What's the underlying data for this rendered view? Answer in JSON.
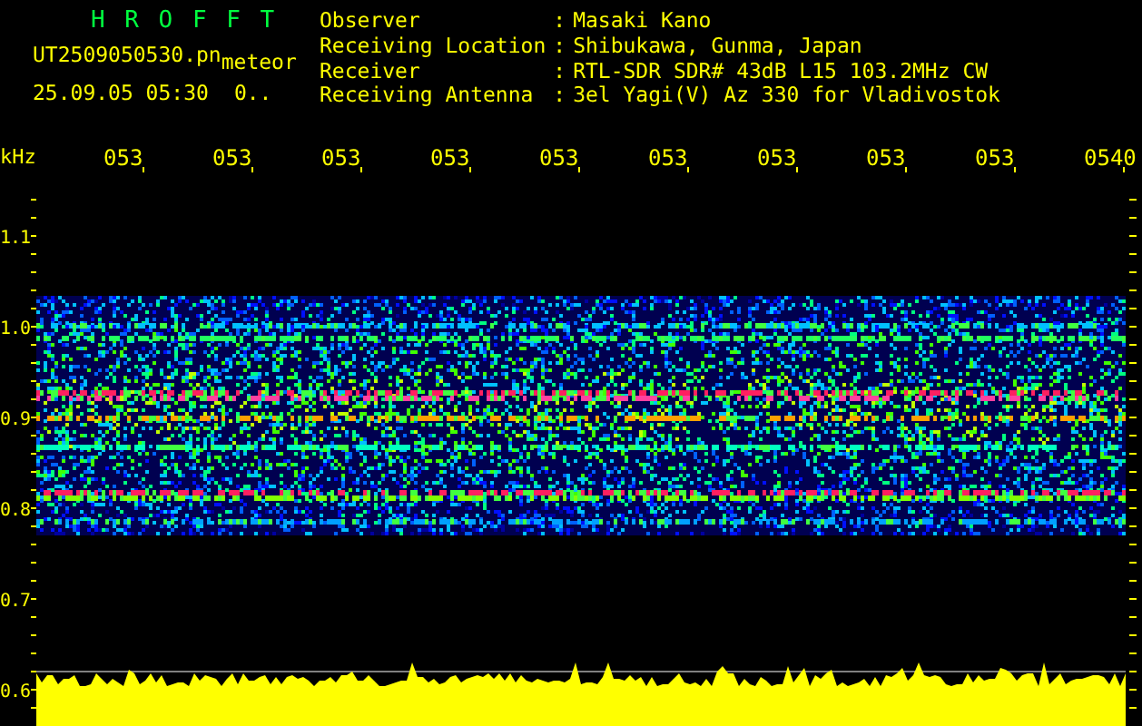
{
  "header": {
    "title": "H R O F F T",
    "file_name": "UT2509050530.pn",
    "mode": "meteor",
    "timestamp": "25.09.05 05:30",
    "counter": "0..",
    "fields": [
      {
        "label": "Observer",
        "separator": ":",
        "value": "Masaki Kano"
      },
      {
        "label": "Receiving Location",
        "separator": ":",
        "value": "Shibukawa, Gunma, Japan"
      },
      {
        "label": "Receiver",
        "separator": ":",
        "value": "RTL-SDR SDR# 43dB L15 103.2MHz CW"
      },
      {
        "label": "Receiving Antenna",
        "separator": ":",
        "value": "3el Yagi(V) Az 330 for Vladivostok"
      }
    ]
  },
  "spectrogram": {
    "unit": "kHz",
    "time_labels": [
      "053",
      "053",
      "053",
      "053",
      "053",
      "053",
      "053",
      "053",
      "053",
      "0540"
    ],
    "frequency_labels": [
      "1.1",
      "1.0",
      "0.9",
      "0.8",
      "0.7",
      "0.6"
    ]
  }
}
